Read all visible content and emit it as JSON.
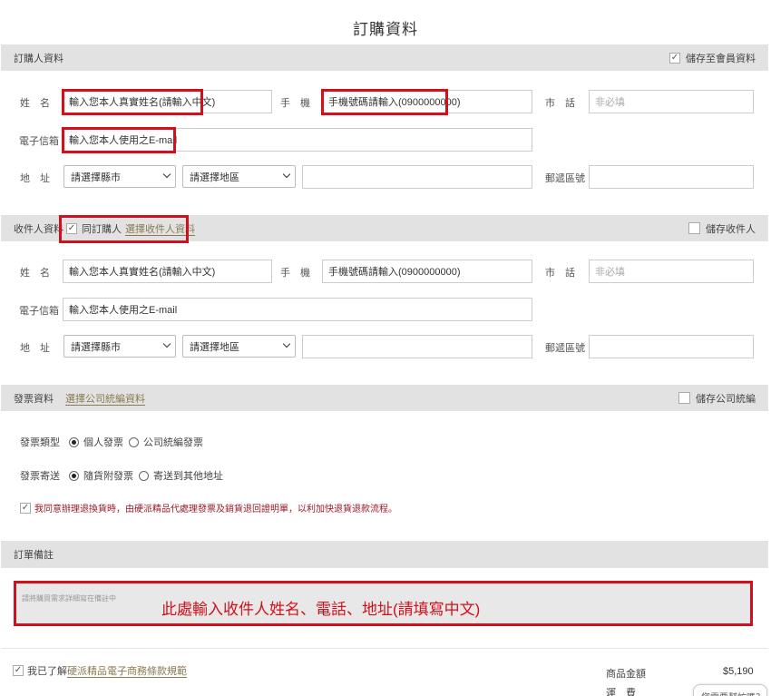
{
  "page_title": "訂購資料",
  "buyer": {
    "section_title": "訂購人資料",
    "save_member_label": "儲存至會員資料",
    "name_label": "姓　名",
    "name_value": "輸入您本人真實姓名(請輸入中文)",
    "mobile_label": "手　機",
    "mobile_value": "手機號碼請輸入(0900000000)",
    "tel_label": "市　話",
    "tel_placeholder": "非必填",
    "email_label": "電子信箱",
    "email_value": "輸入您本人使用之E-mail",
    "address_label": "地　址",
    "city_select": "請選擇縣市",
    "district_select": "請選擇地區",
    "zip_label": "郵遞區號"
  },
  "recipient": {
    "section_title": "收件人資料",
    "same_label": "同訂購人",
    "choose_link": "選擇收件人資料",
    "save_label": "儲存收件人",
    "name_label": "姓　名",
    "name_value": "輸入您本人真實姓名(請輸入中文)",
    "mobile_label": "手　機",
    "mobile_value": "手機號碼請輸入(0900000000)",
    "tel_label": "市　話",
    "tel_placeholder": "非必填",
    "email_label": "電子信箱",
    "email_value": "輸入您本人使用之E-mail",
    "address_label": "地　址",
    "city_select": "請選擇縣市",
    "district_select": "請選擇地區",
    "zip_label": "郵遞區號"
  },
  "invoice": {
    "section_title": "發票資料",
    "choose_link": "選擇公司統編資料",
    "save_label": "儲存公司統編",
    "type_label": "發票類型",
    "type_personal": "個人發票",
    "type_company": "公司統編發票",
    "delivery_label": "發票寄送",
    "delivery_with_goods": "隨貨附發票",
    "delivery_other": "寄送到其他地址",
    "agree_text": "我同意辦理退換貨時，由硬派精品代處理發票及銷貨退回證明單，以利加快退貨退款流程。"
  },
  "order_note": {
    "section_title": "訂單備註",
    "placeholder": "請將購買需求詳細寫在備註中",
    "annotation": "此處輸入收件人姓名、電話、地址(請填寫中文)"
  },
  "footer": {
    "agree_prefix": "我已了解",
    "terms_link": "硬派精品電子商務條款規範",
    "subtotal_label": "商品金額",
    "subtotal_value": "$5,190",
    "shipping_label": "運　費",
    "help_button": "您需要幫忙嗎？"
  },
  "colors": {
    "highlight_red": "#d0101c",
    "section_bar": "#e2e2e2",
    "link_gold": "#8a7a50"
  }
}
